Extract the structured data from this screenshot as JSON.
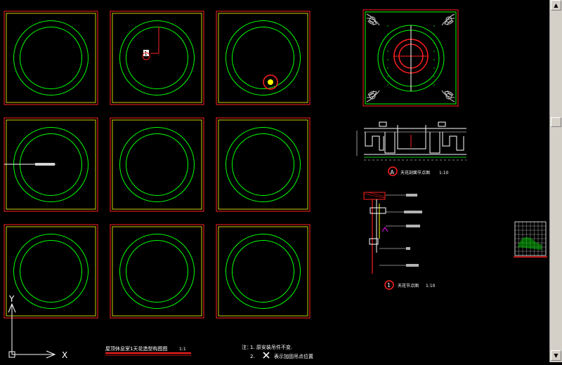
{
  "drawing": {
    "plan_title": "屋顶休息室1天花造型构图图",
    "plan_scale": "1:1",
    "section_a_marker": "A",
    "section_a_title": "天花剖面节点图",
    "section_a_scale": "1:10",
    "detail_1_marker": "1",
    "detail_1_title": "天花节点图",
    "detail_1_scale": "1:10",
    "note_prefix": "注：",
    "note_line1": "1. 原安装吊件不变.",
    "note_line2_num": "2.",
    "note_line2_text": "表示加固吊点位置",
    "marker_label": "1"
  },
  "ucs": {
    "x_label": "X",
    "y_label": "Y"
  },
  "scrollbar": {
    "up_arrow": "▲",
    "down_arrow": "▼"
  },
  "colors": {
    "background": "#000000",
    "frame_red": "#ff2020",
    "frame_yellow": "#ffff00",
    "circle_green": "#00ff00",
    "line_white": "#ffffff",
    "magenta": "#ff00ff"
  }
}
